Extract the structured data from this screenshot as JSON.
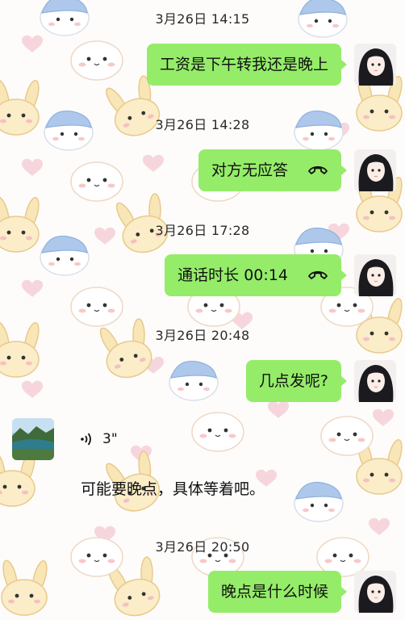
{
  "messages": [
    {
      "time": "3月26日 14:15",
      "text": "工资是下午转我还是晚上"
    },
    {
      "time": "3月26日 14:28",
      "text": "对方无应答"
    },
    {
      "time": "3月26日 17:28",
      "text": "通话时长 00:14"
    },
    {
      "time": "3月26日 20:48",
      "text": "几点发呢?"
    },
    {
      "voice_duration": "3\"",
      "transcript": "可能要晚点，具体等着吧。"
    },
    {
      "time": "3月26日 20:50",
      "text": "晚点是什么时候"
    }
  ],
  "colors": {
    "sent_bubble": "#95ec69",
    "text": "#111111"
  },
  "icons": {
    "call": "phone-hangup-icon",
    "voice": "voice-wave-icon"
  }
}
